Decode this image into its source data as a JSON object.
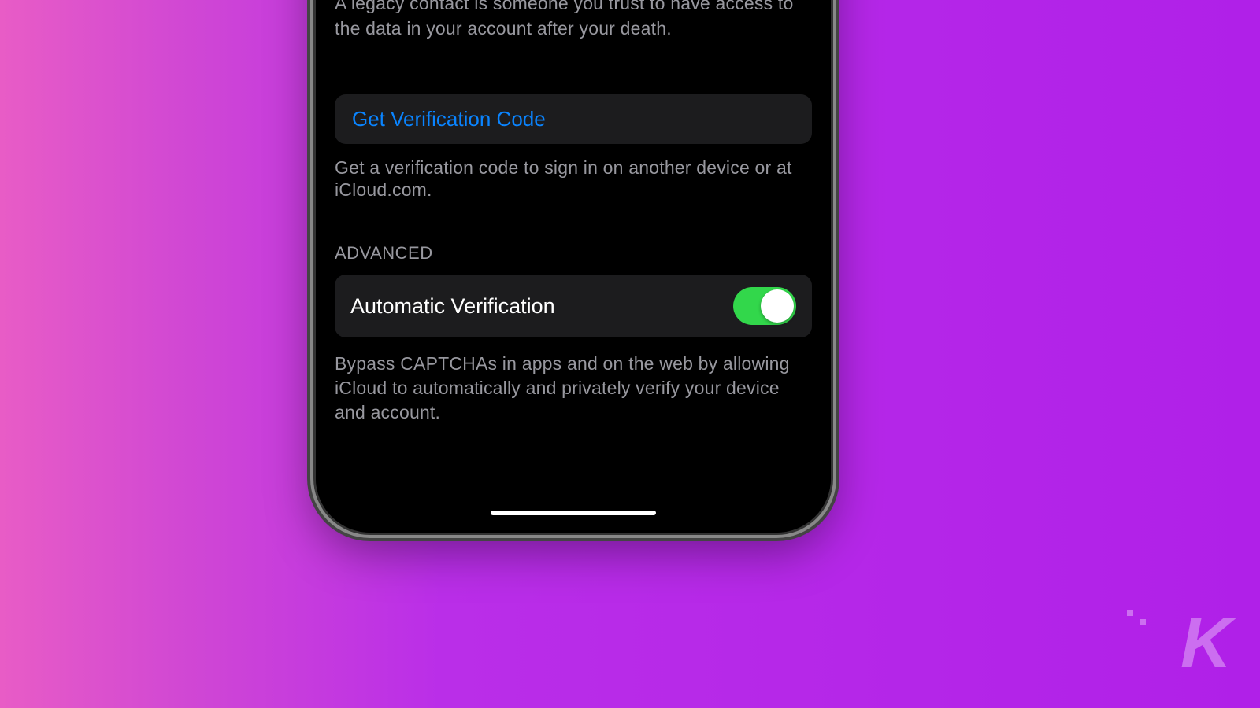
{
  "legacy": {
    "description": "A legacy contact is someone you trust to have access to the data in your account after your death."
  },
  "verification": {
    "button_label": "Get Verification Code",
    "footer": "Get a verification code to sign in on another device or at iCloud.com."
  },
  "advanced": {
    "header": "ADVANCED",
    "auto_verify_label": "Automatic Verification",
    "auto_verify_enabled": true,
    "footer": "Bypass CAPTCHAs in apps and on the web by allowing iCloud to automatically and privately verify your device and account."
  },
  "watermark": "K"
}
